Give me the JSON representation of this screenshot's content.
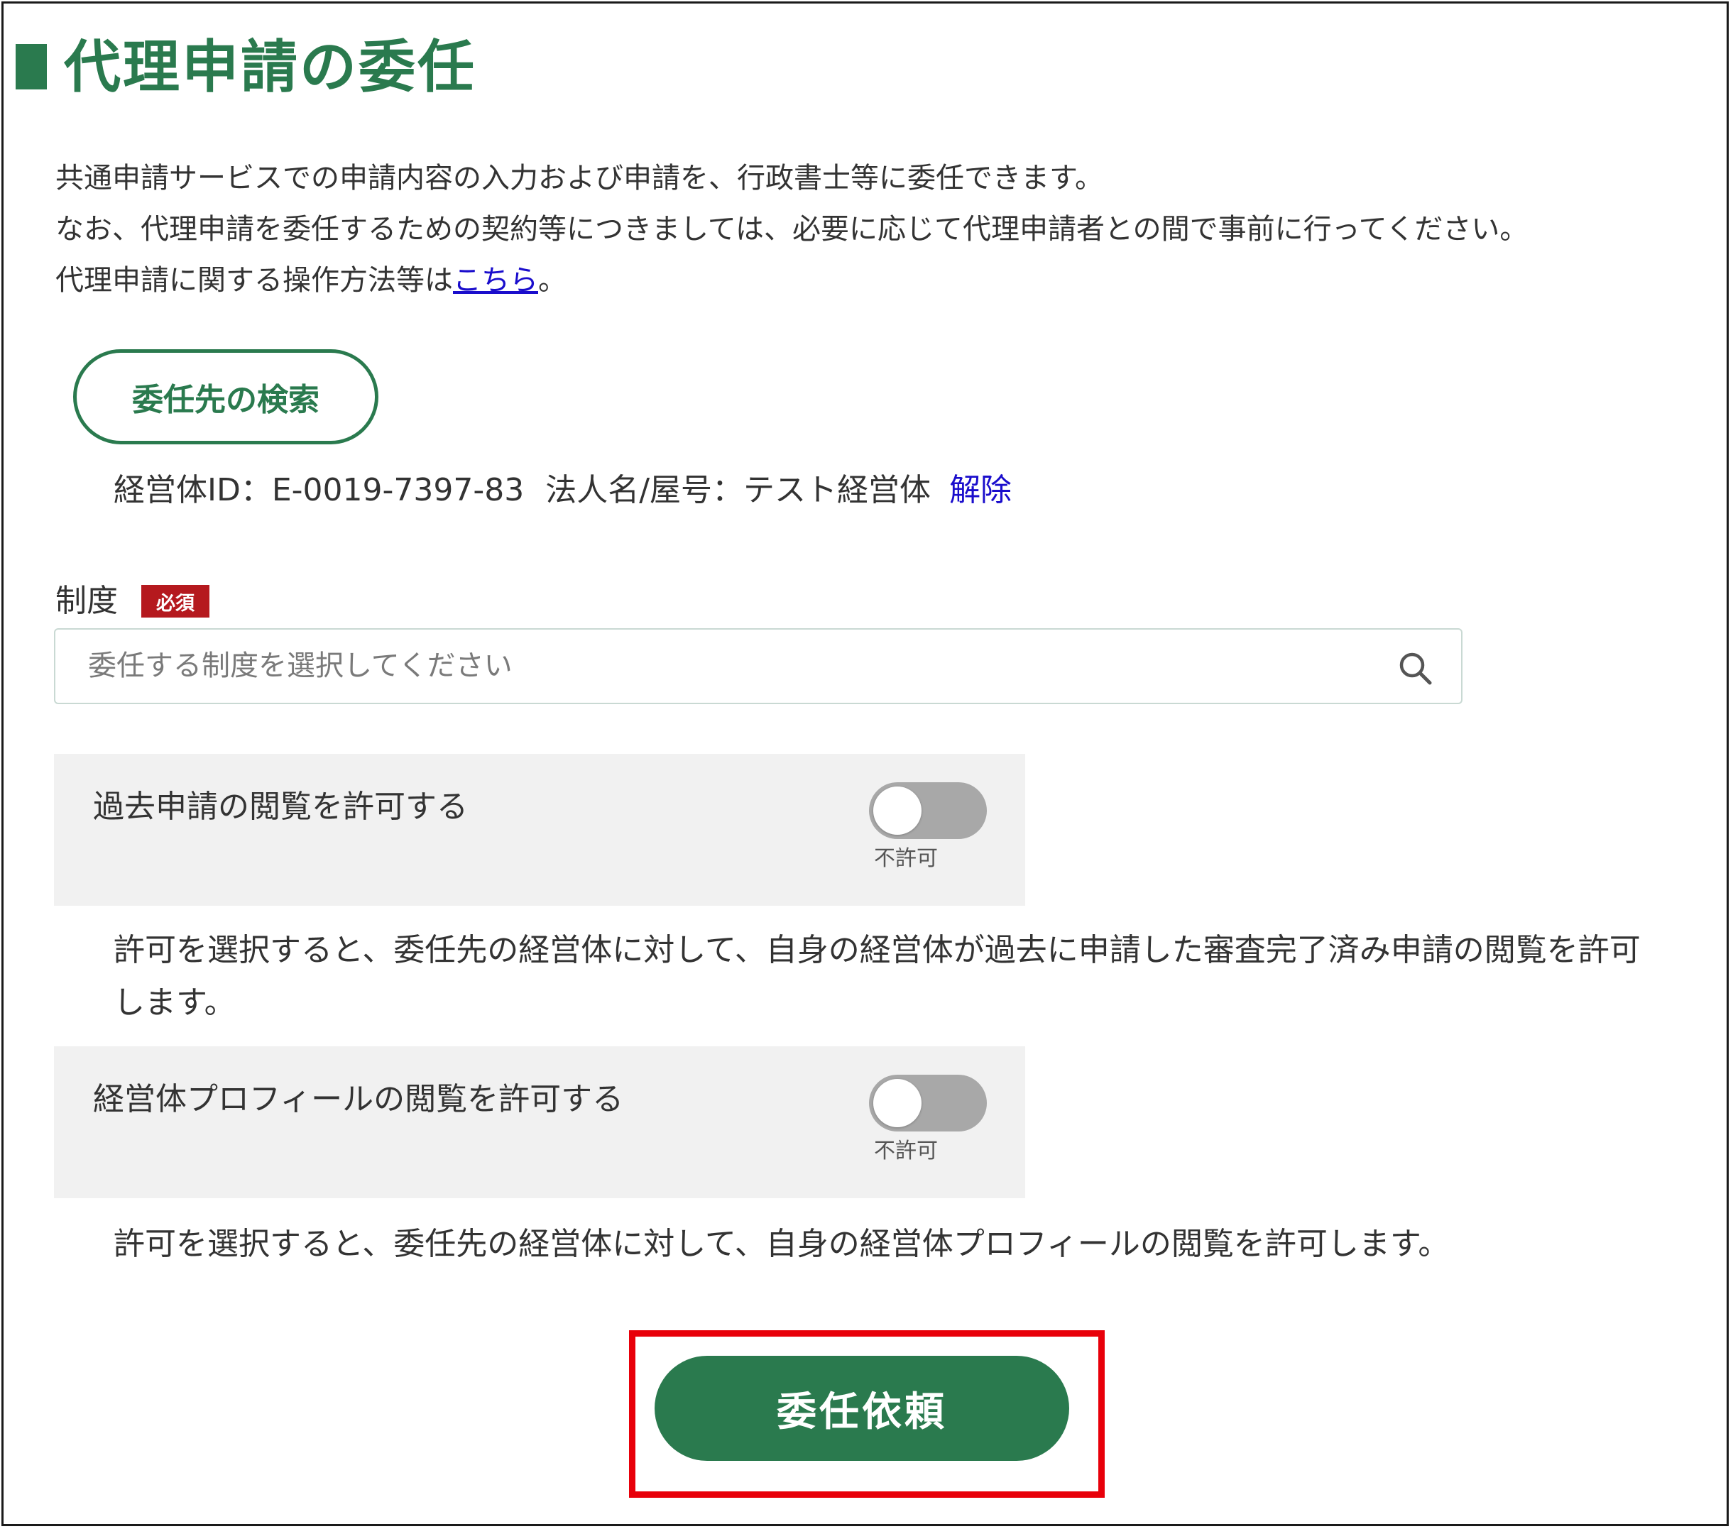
{
  "colors": {
    "brand_green": "#2a7a4e",
    "link_blue": "#1a0dcc",
    "required_red": "#b5191e",
    "highlight_red": "#e8000a",
    "toggle_off_gray": "#a8a8a8",
    "panel_gray": "#f1f1f1"
  },
  "page": {
    "title": "代理申請の委任",
    "intro": {
      "line1": "共通申請サービスでの申請内容の入力および申請を、行政書士等に委任できます。",
      "line2": "なお、代理申請を委任するための契約等につきましては、必要に応じて代理申請者との間で事前に行ってください。",
      "line3_prefix": "代理申請に関する操作方法等は",
      "line3_link": "こちら",
      "line3_suffix": "。"
    }
  },
  "delegate": {
    "search_button": "委任先の検索",
    "entity_id": "経営体ID：E-0019-7397-83",
    "entity_name": "法人名/屋号：テスト経営体",
    "cancel_link": "解除"
  },
  "system_field": {
    "label": "制度",
    "required_badge": "必須",
    "placeholder": "委任する制度を選択してください",
    "icon": "search-icon"
  },
  "permissions": [
    {
      "label": "過去申請の閲覧を許可する",
      "state_label": "不許可",
      "enabled": false,
      "description": "許可を選択すると、委任先の経営体に対して、自身の経営体が過去に申請した審査完了済み申請の閲覧を許可します。"
    },
    {
      "label": "経営体プロフィールの閲覧を許可する",
      "state_label": "不許可",
      "enabled": false,
      "description": "許可を選択すると、委任先の経営体に対して、自身の経営体プロフィールの閲覧を許可します。"
    }
  ],
  "submit": {
    "label": "委任依頼"
  }
}
